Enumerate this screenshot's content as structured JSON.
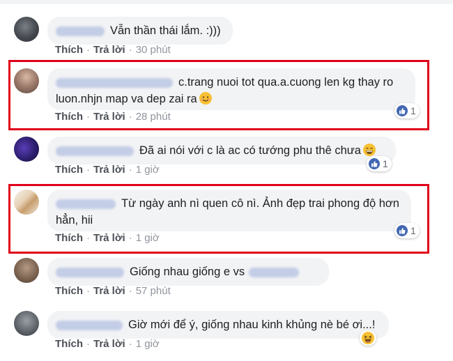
{
  "colors": {
    "highlight": "#e0001a",
    "bubble": "#f2f3f5",
    "like": "#4267b2"
  },
  "actions": {
    "like": "Thích",
    "reply": "Trả lời",
    "separator": "·"
  },
  "comments": [
    {
      "text": "Vẫn thần thái lắm. :)))",
      "time": "30 phút",
      "reaction": null,
      "highlighted": false
    },
    {
      "text": "c.trang nuoi tot qua.a.cuong len kg thay ro luon.nhjn map va dep zai ra",
      "emoji": "smiling-face-icon",
      "time": "28 phút",
      "reaction": {
        "type": "like-icon",
        "count": "1"
      },
      "highlighted": true
    },
    {
      "text": "Đã ai nói với c là ac có tướng phu thê chưa",
      "emoji": "grinning-face-icon",
      "time": "1 giờ",
      "reaction": {
        "type": "like-icon",
        "count": "1"
      },
      "highlighted": false
    },
    {
      "text": "Từ ngày anh nì quen cô nì. Ảnh đẹp trai phong độ hơn hẳn, hii",
      "time": "1 giờ",
      "reaction": {
        "type": "like-icon",
        "count": "1"
      },
      "highlighted": true
    },
    {
      "text": "Giống nhau giống e vs",
      "time": "57 phút",
      "reaction": null,
      "highlighted": false
    },
    {
      "text": "Giờ mới để ý, giống nhau kinh khủng nè bé ơi...!",
      "time": "1 giờ",
      "reaction": {
        "type": "haha-icon",
        "count": ""
      },
      "highlighted": false
    }
  ]
}
